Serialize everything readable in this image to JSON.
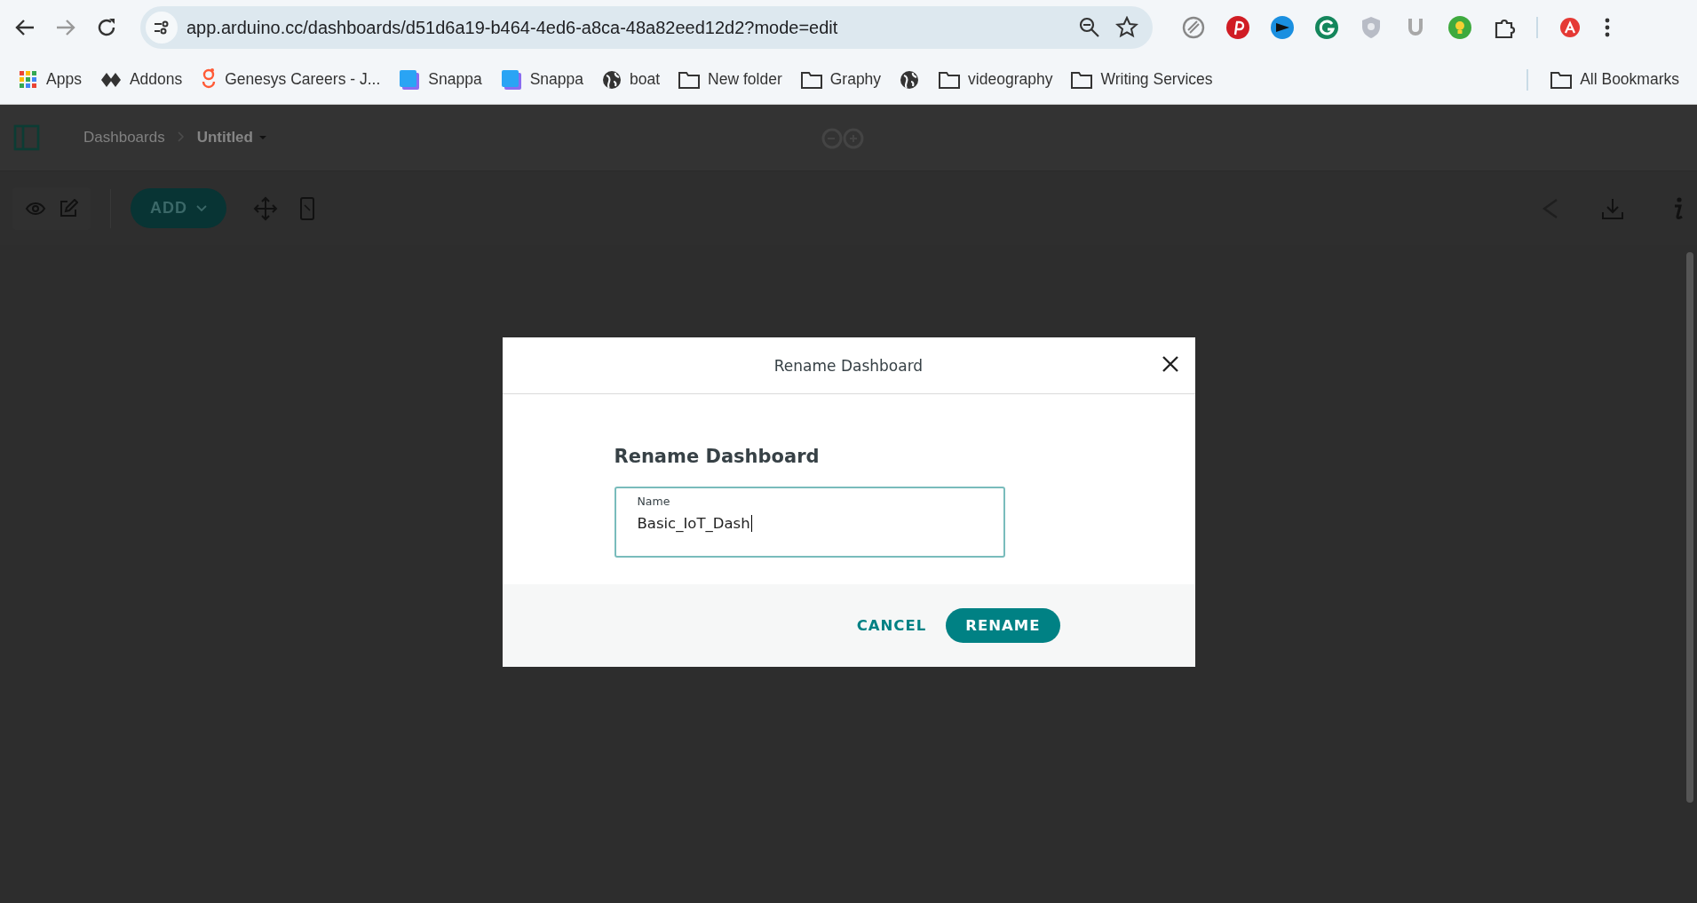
{
  "browser": {
    "url": "app.arduino.cc/dashboards/d51d6a19-b464-4ed6-a8ca-48a82eed12d2?mode=edit"
  },
  "bookmarks": [
    {
      "label": "Apps",
      "kind": "apps"
    },
    {
      "label": "Addons",
      "kind": "addons"
    },
    {
      "label": "Genesys Careers - J...",
      "kind": "genesys"
    },
    {
      "label": "Snappa",
      "kind": "snappa"
    },
    {
      "label": "Snappa",
      "kind": "snappa"
    },
    {
      "label": "boat",
      "kind": "globe"
    },
    {
      "label": "New folder",
      "kind": "folder"
    },
    {
      "label": "Graphy",
      "kind": "folder"
    },
    {
      "kind": "globe"
    },
    {
      "label": "videography",
      "kind": "folder"
    },
    {
      "label": "Writing Services",
      "kind": "folder"
    }
  ],
  "all_bookmarks": "All Bookmarks",
  "breadcrumb": {
    "parent": "Dashboards",
    "current": "Untitled"
  },
  "toolbar": {
    "add_button": "ADD"
  },
  "dialog": {
    "title": "Rename Dashboard",
    "heading": "Rename Dashboard",
    "field": {
      "label": "Name",
      "value": "Basic_IoT_Dash"
    },
    "buttons": [
      {
        "label": "CANCEL",
        "kind": "text"
      },
      {
        "label": "RENAME",
        "kind": "primary"
      }
    ]
  }
}
